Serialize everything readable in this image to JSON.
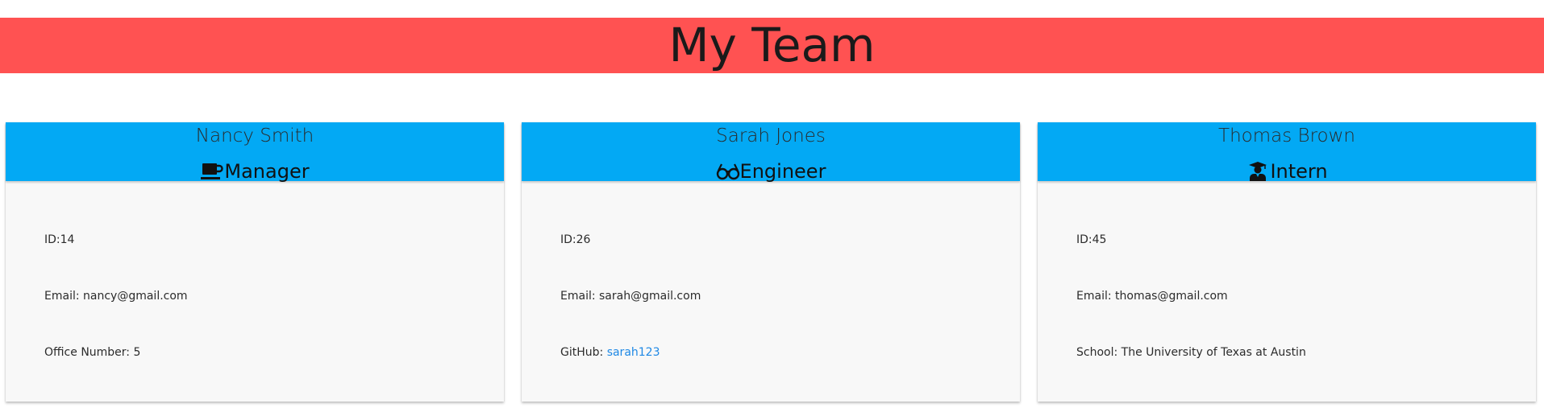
{
  "header": {
    "title": "My Team"
  },
  "cards": [
    {
      "name": "Nancy Smith",
      "role": "Manager",
      "role_icon": "coffee-mug-icon",
      "id_label": "ID:",
      "id_value": "14",
      "email_label": "Email: ",
      "email_value": "nancy@gmail.com",
      "extra_label": "Office Number: ",
      "extra_value": "5"
    },
    {
      "name": "Sarah Jones",
      "role": "Engineer",
      "role_icon": "glasses-icon",
      "id_label": "ID:",
      "id_value": "26",
      "email_label": "Email: ",
      "email_value": "sarah@gmail.com",
      "extra_label": "GitHub: ",
      "extra_value": "sarah123"
    },
    {
      "name": "Thomas Brown",
      "role": "Intern",
      "role_icon": "graduate-icon",
      "id_label": "ID:",
      "id_value": "45",
      "email_label": "Email: ",
      "email_value": "thomas@gmail.com",
      "extra_label": "School: ",
      "extra_value": "The University of Texas at Austin"
    }
  ],
  "colors": {
    "banner": "#ff5252",
    "card_header": "#03a9f4",
    "card_body": "#f8f8f8",
    "link": "#1e88e5"
  }
}
